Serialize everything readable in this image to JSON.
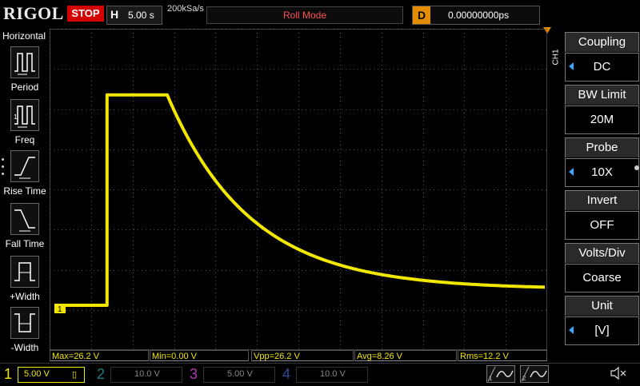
{
  "brand": "RIGOL",
  "run_state": "STOP",
  "timebase": {
    "label": "H",
    "value": "5.00 s"
  },
  "sample_rate": "200kSa/s",
  "acquire_mode": "Roll Mode",
  "delay": {
    "label": "D",
    "value": "0.00000000ps"
  },
  "left_menu": {
    "title": "Horizontal",
    "items": [
      {
        "label": "Period",
        "icon": "period-icon"
      },
      {
        "label": "Freq",
        "icon": "freq-icon"
      },
      {
        "label": "Rise Time",
        "icon": "rise-time-icon"
      },
      {
        "label": "Fall Time",
        "icon": "fall-time-icon"
      },
      {
        "label": "+Width",
        "icon": "plus-width-icon"
      },
      {
        "label": "-Width",
        "icon": "minus-width-icon"
      }
    ]
  },
  "right_menu": {
    "channel_tag": "CH1",
    "items": [
      {
        "title": "Coupling",
        "value": "DC",
        "has_arrow": true
      },
      {
        "title": "BW Limit",
        "value": "20M",
        "has_arrow": false
      },
      {
        "title": "Probe",
        "value": "10X",
        "has_arrow": true
      },
      {
        "title": "Invert",
        "value": "OFF",
        "has_arrow": false
      },
      {
        "title": "Volts/Div",
        "value": "Coarse",
        "has_arrow": false
      },
      {
        "title": "Unit",
        "value": "[V]",
        "has_arrow": true
      }
    ]
  },
  "measurements": [
    "Max=26.2 V",
    "Min=0.00 V",
    "Vpp=26.2 V",
    "Avg=8.26 V",
    "Rms=12.2 V"
  ],
  "channels": [
    {
      "num": "1",
      "scale": "5.00 V"
    },
    {
      "num": "2",
      "scale": "10.0 V"
    },
    {
      "num": "3",
      "scale": "5.00 V"
    },
    {
      "num": "4",
      "scale": "10.0 V"
    }
  ],
  "trigger_buttons": [
    "1",
    "2"
  ],
  "ground_marker": "1",
  "colors": {
    "ch1": "#f2e700",
    "stop": "#d40000",
    "delay": "#e38c00",
    "grid": "#555555"
  },
  "waveform": {
    "description_units": "volts vs time (s)",
    "baseline_v": 0.0,
    "high_v": 26.2,
    "step_time_div": 1.0,
    "decay_start_div": 2.45,
    "decay_tau_div": 2.0,
    "volts_per_div": 5.0,
    "time_per_div": 5.0
  }
}
